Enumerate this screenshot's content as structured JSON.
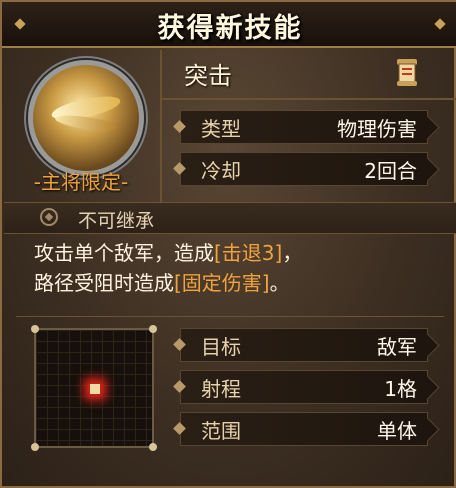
{
  "title": "获得新技能",
  "skill": {
    "icon": "slash-medal-icon",
    "restriction_label": "-主将限定-",
    "name": "突击",
    "stats": [
      {
        "label": "类型",
        "value": "物理伤害"
      },
      {
        "label": "冷却",
        "value": "2回合"
      }
    ],
    "inherit_text": "不可继承",
    "description": {
      "part1": "攻击单个敌军，造成",
      "highlight1": "[击退3]",
      "part2": "，",
      "part3": "路径受阻时造成",
      "highlight2": "[固定伤害]",
      "part4": "。"
    },
    "range_stats": [
      {
        "label": "目标",
        "value": "敌军"
      },
      {
        "label": "射程",
        "value": "1格"
      },
      {
        "label": "范围",
        "value": "单体"
      }
    ]
  },
  "colors": {
    "highlight": "#f1a340",
    "label": "#e8d3ad",
    "target": "#e8261a"
  }
}
